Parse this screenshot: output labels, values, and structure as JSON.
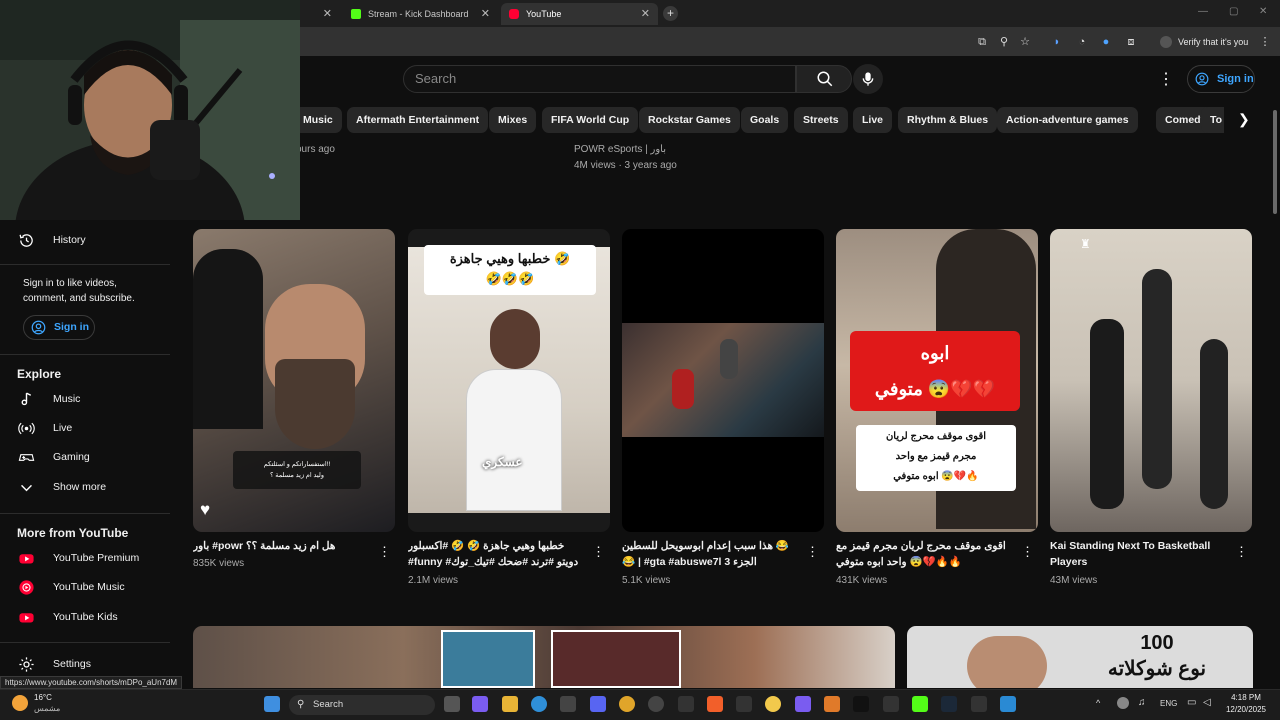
{
  "browser": {
    "tabs": [
      {
        "label": "",
        "favicon": "",
        "active": false
      },
      {
        "label": "Stream - Kick Dashboard",
        "favicon": "kick-icon",
        "active": false
      },
      {
        "label": "YouTube",
        "favicon": "youtube-icon",
        "active": true
      }
    ],
    "profile_label": "Verify that it's you"
  },
  "header": {
    "search_placeholder": "Search",
    "signin_label": "Sign in"
  },
  "chips": [
    "Music",
    "Aftermath Entertainment",
    "Mixes",
    "FIFA World Cup",
    "Rockstar Games",
    "Goals",
    "Streets",
    "Live",
    "Rhythm & Blues",
    "Action-adventure games",
    "Comedy",
    "To"
  ],
  "top_row": {
    "left_time_partial": "ours ago",
    "channel": "POWR eSports | باور",
    "meta": "4M views · 3 years ago"
  },
  "sidebar": {
    "history_label": "History",
    "signin_text": "Sign in to like videos, comment, and subscribe.",
    "signin_button": "Sign in",
    "explore_heading": "Explore",
    "explore_items": [
      {
        "label": "Music",
        "icon": "music-note-icon"
      },
      {
        "label": "Live",
        "icon": "live-icon"
      },
      {
        "label": "Gaming",
        "icon": "gamepad-icon"
      },
      {
        "label": "Show more",
        "icon": "chevron-down-icon"
      }
    ],
    "more_heading": "More from YouTube",
    "more_items": [
      {
        "label": "YouTube Premium",
        "icon": "youtube-premium-icon"
      },
      {
        "label": "YouTube Music",
        "icon": "youtube-music-icon"
      },
      {
        "label": "YouTube Kids",
        "icon": "youtube-kids-icon"
      }
    ],
    "settings_label": "Settings"
  },
  "shorts": [
    {
      "title": "باور #powr هل ام زيد مسلمة ؟؟",
      "views": "835K views",
      "overlay_text": "استفساراتكم و اسئلتكم!!\nوليد ام زيد مسلمة ؟"
    },
    {
      "title": "خطبها وهيي جاهزة 🤣 🤣 #اكسبلور #funny #دويتو #ترند #ضحك #تيك_توك #اكسبلور #دويتو #ترند ...",
      "views": "2.1M views",
      "overlay_text": "خطبها وهيي جاهزة 🤣\n🤣🤣🤣",
      "overlay_text2": "عسكري"
    },
    {
      "title": "هذا سبب إعدام ابوسويحل للسطين 😂😂 | #gta #abuswe7l الجزء 3 #اكسبلور ...",
      "views": "5.1K views"
    },
    {
      "title": "اقوى موقف محرج لريان مجرم قيمز مع واحد ابوه متوفي 😨💔🔥🔥",
      "views": "431K views",
      "overlay_text": "ابوه\nمتوفي 😨💔💔",
      "overlay_text2": "اقوى موقف محرج لريان\nمجرم قيمز مع واحد\nابوه متوفي 😨💔🔥"
    },
    {
      "title": "Kai Standing Next To Basketball Players",
      "views": "43M views"
    }
  ],
  "bottom_row": {
    "thumb_text": "100\nنوع شوكلاته"
  },
  "status_url": "https://www.youtube.com/shorts/mDPo_aUn7dM",
  "taskbar": {
    "search_label": "Search",
    "weather_temp": "16°C",
    "weather_desc": "مشمس",
    "language": "ENG",
    "time": "4:18 PM",
    "date": "12/20/2025"
  }
}
